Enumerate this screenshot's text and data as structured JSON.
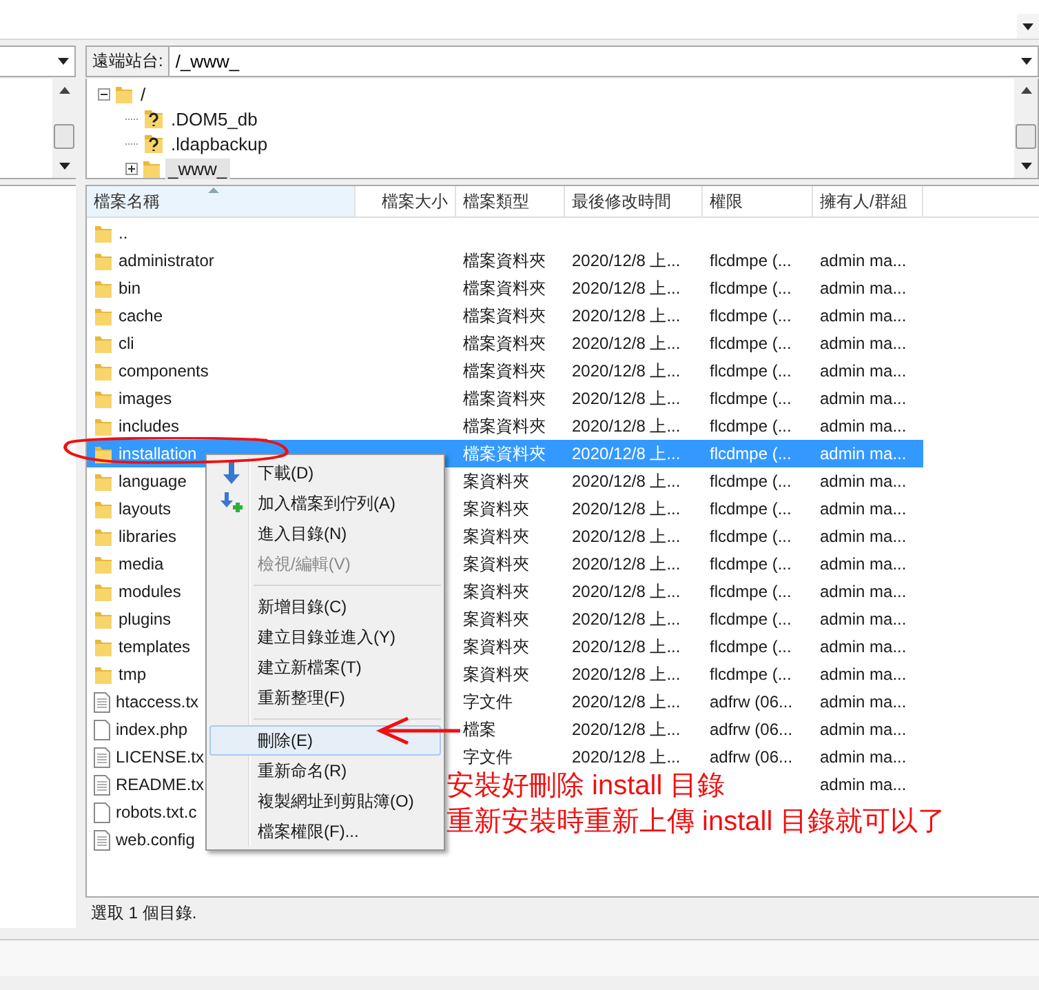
{
  "remote_site": {
    "label": "遠端站台:",
    "value": "/_www_"
  },
  "tree": [
    {
      "name": "/",
      "kind": "folder",
      "expanded": true,
      "selected": false,
      "children": [
        {
          "name": ".DOM5_db",
          "kind": "unknown",
          "selected": false
        },
        {
          "name": ".ldapbackup",
          "kind": "unknown",
          "selected": false
        },
        {
          "name": "_www_",
          "kind": "folder",
          "expanded": false,
          "selected": true
        }
      ]
    }
  ],
  "file_list": {
    "columns": [
      "檔案名稱",
      "檔案大小",
      "檔案類型",
      "最後修改時間",
      "權限",
      "擁有人/群組"
    ],
    "rows": [
      {
        "name": "..",
        "kind": "folder",
        "selected": false
      },
      {
        "name": "administrator",
        "kind": "folder",
        "selected": false,
        "type": "檔案資料夾",
        "modified": "2020/12/8 上...",
        "permissions": "flcdmpe (...",
        "owner": "admin ma..."
      },
      {
        "name": "bin",
        "kind": "folder",
        "selected": false,
        "type": "檔案資料夾",
        "modified": "2020/12/8 上...",
        "permissions": "flcdmpe (...",
        "owner": "admin ma..."
      },
      {
        "name": "cache",
        "kind": "folder",
        "selected": false,
        "type": "檔案資料夾",
        "modified": "2020/12/8 上...",
        "permissions": "flcdmpe (...",
        "owner": "admin ma..."
      },
      {
        "name": "cli",
        "kind": "folder",
        "selected": false,
        "type": "檔案資料夾",
        "modified": "2020/12/8 上...",
        "permissions": "flcdmpe (...",
        "owner": "admin ma..."
      },
      {
        "name": "components",
        "kind": "folder",
        "selected": false,
        "type": "檔案資料夾",
        "modified": "2020/12/8 上...",
        "permissions": "flcdmpe (...",
        "owner": "admin ma..."
      },
      {
        "name": "images",
        "kind": "folder",
        "selected": false,
        "type": "檔案資料夾",
        "modified": "2020/12/8 上...",
        "permissions": "flcdmpe (...",
        "owner": "admin ma..."
      },
      {
        "name": "includes",
        "kind": "folder",
        "selected": false,
        "type": "檔案資料夾",
        "modified": "2020/12/8 上...",
        "permissions": "flcdmpe (...",
        "owner": "admin ma..."
      },
      {
        "name": "installation",
        "kind": "folder",
        "selected": true,
        "type": "檔案資料夾",
        "modified": "2020/12/8 上...",
        "permissions": "flcdmpe (...",
        "owner": "admin ma..."
      },
      {
        "name": "language",
        "kind": "folder",
        "selected": false,
        "type": "案資料夾",
        "modified": "2020/12/8 上...",
        "permissions": "flcdmpe (...",
        "owner": "admin ma..."
      },
      {
        "name": "layouts",
        "kind": "folder",
        "selected": false,
        "type": "案資料夾",
        "modified": "2020/12/8 上...",
        "permissions": "flcdmpe (...",
        "owner": "admin ma..."
      },
      {
        "name": "libraries",
        "kind": "folder",
        "selected": false,
        "type": "案資料夾",
        "modified": "2020/12/8 上...",
        "permissions": "flcdmpe (...",
        "owner": "admin ma..."
      },
      {
        "name": "media",
        "kind": "folder",
        "selected": false,
        "type": "案資料夾",
        "modified": "2020/12/8 上...",
        "permissions": "flcdmpe (...",
        "owner": "admin ma..."
      },
      {
        "name": "modules",
        "kind": "folder",
        "selected": false,
        "type": "案資料夾",
        "modified": "2020/12/8 上...",
        "permissions": "flcdmpe (...",
        "owner": "admin ma..."
      },
      {
        "name": "plugins",
        "kind": "folder",
        "selected": false,
        "type": "案資料夾",
        "modified": "2020/12/8 上...",
        "permissions": "flcdmpe (...",
        "owner": "admin ma..."
      },
      {
        "name": "templates",
        "kind": "folder",
        "selected": false,
        "type": "案資料夾",
        "modified": "2020/12/8 上...",
        "permissions": "flcdmpe (...",
        "owner": "admin ma..."
      },
      {
        "name": "tmp",
        "kind": "folder",
        "selected": false,
        "type": "案資料夾",
        "modified": "2020/12/8 上...",
        "permissions": "flcdmpe (...",
        "owner": "admin ma..."
      },
      {
        "name": "htaccess.tx",
        "kind": "text",
        "selected": false,
        "type": "字文件",
        "modified": "2020/12/8 上...",
        "permissions": "adfrw (06...",
        "owner": "admin ma..."
      },
      {
        "name": "index.php",
        "kind": "file",
        "selected": false,
        "type": "檔案",
        "modified": "2020/12/8 上...",
        "permissions": "adfrw (06...",
        "owner": "admin ma..."
      },
      {
        "name": "LICENSE.tx",
        "kind": "text",
        "selected": false,
        "type": "字文件",
        "modified": "2020/12/8 上...",
        "permissions": "adfrw (06...",
        "owner": "admin ma..."
      },
      {
        "name": "README.tx",
        "kind": "text",
        "selected": false,
        "owner": "admin ma..."
      },
      {
        "name": "robots.txt.c",
        "kind": "file",
        "selected": false
      },
      {
        "name": "web.config",
        "kind": "text",
        "selected": false
      }
    ]
  },
  "context_menu": [
    {
      "kind": "item",
      "label": "下載(D)",
      "disabled": false,
      "selected": false
    },
    {
      "kind": "item",
      "label": "加入檔案到佇列(A)",
      "disabled": false,
      "selected": false
    },
    {
      "kind": "item",
      "label": "進入目錄(N)",
      "disabled": false,
      "selected": false
    },
    {
      "kind": "item",
      "label": "檢視/編輯(V)",
      "disabled": true,
      "selected": false
    },
    {
      "kind": "separator"
    },
    {
      "kind": "item",
      "label": "新增目錄(C)",
      "disabled": false,
      "selected": false
    },
    {
      "kind": "item",
      "label": "建立目錄並進入(Y)",
      "disabled": false,
      "selected": false
    },
    {
      "kind": "item",
      "label": "建立新檔案(T)",
      "disabled": false,
      "selected": false
    },
    {
      "kind": "item",
      "label": "重新整理(F)",
      "disabled": false,
      "selected": false
    },
    {
      "kind": "separator"
    },
    {
      "kind": "item",
      "label": "刪除(E)",
      "disabled": false,
      "selected": true
    },
    {
      "kind": "item",
      "label": "重新命名(R)",
      "disabled": false,
      "selected": false
    },
    {
      "kind": "item",
      "label": "複製網址到剪貼簿(O)",
      "disabled": false,
      "selected": false
    },
    {
      "kind": "item",
      "label": "檔案權限(F)...",
      "disabled": false,
      "selected": false
    }
  ],
  "status_bar": "選取 1 個目錄.",
  "annotation": {
    "lines": [
      "安裝好刪除 install 目錄",
      "重新安裝時重新上傳 install 目錄就可以了"
    ]
  }
}
